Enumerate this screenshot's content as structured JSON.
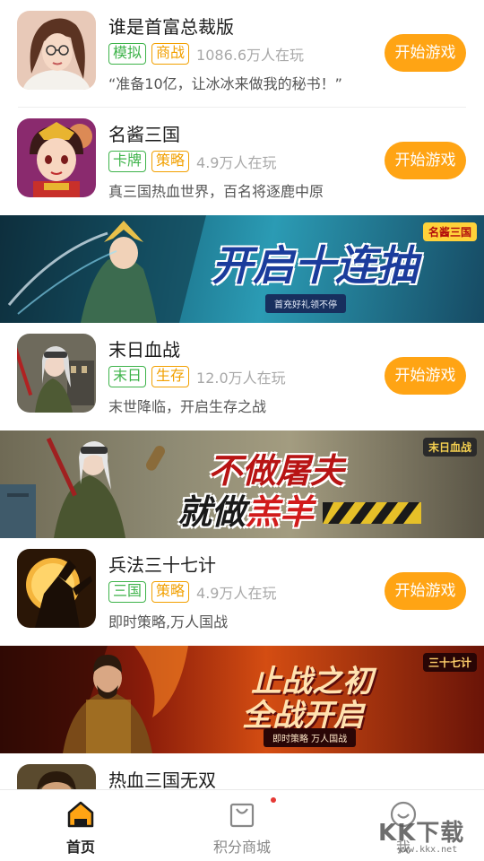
{
  "games": [
    {
      "name": "谁是首富总裁版",
      "tags": [
        {
          "label": "模拟",
          "color": "green"
        },
        {
          "label": "商战",
          "color": "orange"
        }
      ],
      "players": "1086.6万人在玩",
      "desc": "“准备10亿，让冰冰来做我的秘书！”",
      "button": "开始游戏",
      "icon": "businesswoman-avatar-icon"
    },
    {
      "name": "名酱三国",
      "tags": [
        {
          "label": "卡牌",
          "color": "green"
        },
        {
          "label": "策略",
          "color": "orange"
        }
      ],
      "players": "4.9万人在玩",
      "desc": "真三国热血世界，百名将逐鹿中原",
      "button": "开始游戏",
      "icon": "chibi-general-icon"
    },
    {
      "name": "末日血战",
      "tags": [
        {
          "label": "末日",
          "color": "green"
        },
        {
          "label": "生存",
          "color": "orange"
        }
      ],
      "players": "12.0万人在玩",
      "desc": "末世降临，开启生存之战",
      "button": "开始游戏",
      "icon": "survivor-girl-icon"
    },
    {
      "name": "兵法三十七计",
      "tags": [
        {
          "label": "三国",
          "color": "green"
        },
        {
          "label": "策略",
          "color": "orange"
        }
      ],
      "players": "4.9万人在玩",
      "desc": "即时策略,万人国战",
      "button": "开始游戏",
      "icon": "warrior-moon-icon"
    },
    {
      "name": "热血三国无双",
      "icon": "warlord-icon"
    }
  ],
  "banners": [
    {
      "slogan": "开启十连抽",
      "caption": "首充好礼领不停",
      "logo": "名酱三国"
    },
    {
      "slogan_line1": "不做屠夫",
      "slogan_line2_a": "就做",
      "slogan_line2_b": "羔羊",
      "logo": "末日血战"
    },
    {
      "slogan_line1": "止战之初",
      "slogan_line2": "全战开启",
      "caption": "即时策略  万人国战",
      "logo": "三十七计"
    }
  ],
  "nav": [
    {
      "label": "首页",
      "icon": "home-icon",
      "active": true
    },
    {
      "label": "积分商城",
      "icon": "shopping-bag-icon",
      "active": false,
      "badge": true
    },
    {
      "label": "我",
      "icon": "user-icon",
      "active": false
    }
  ],
  "watermark": {
    "text": "KK下载",
    "url": "www.kkx.net"
  },
  "colors": {
    "accent": "#ffa414",
    "tag_green": "#3eb34a",
    "tag_orange": "#f2a000"
  }
}
